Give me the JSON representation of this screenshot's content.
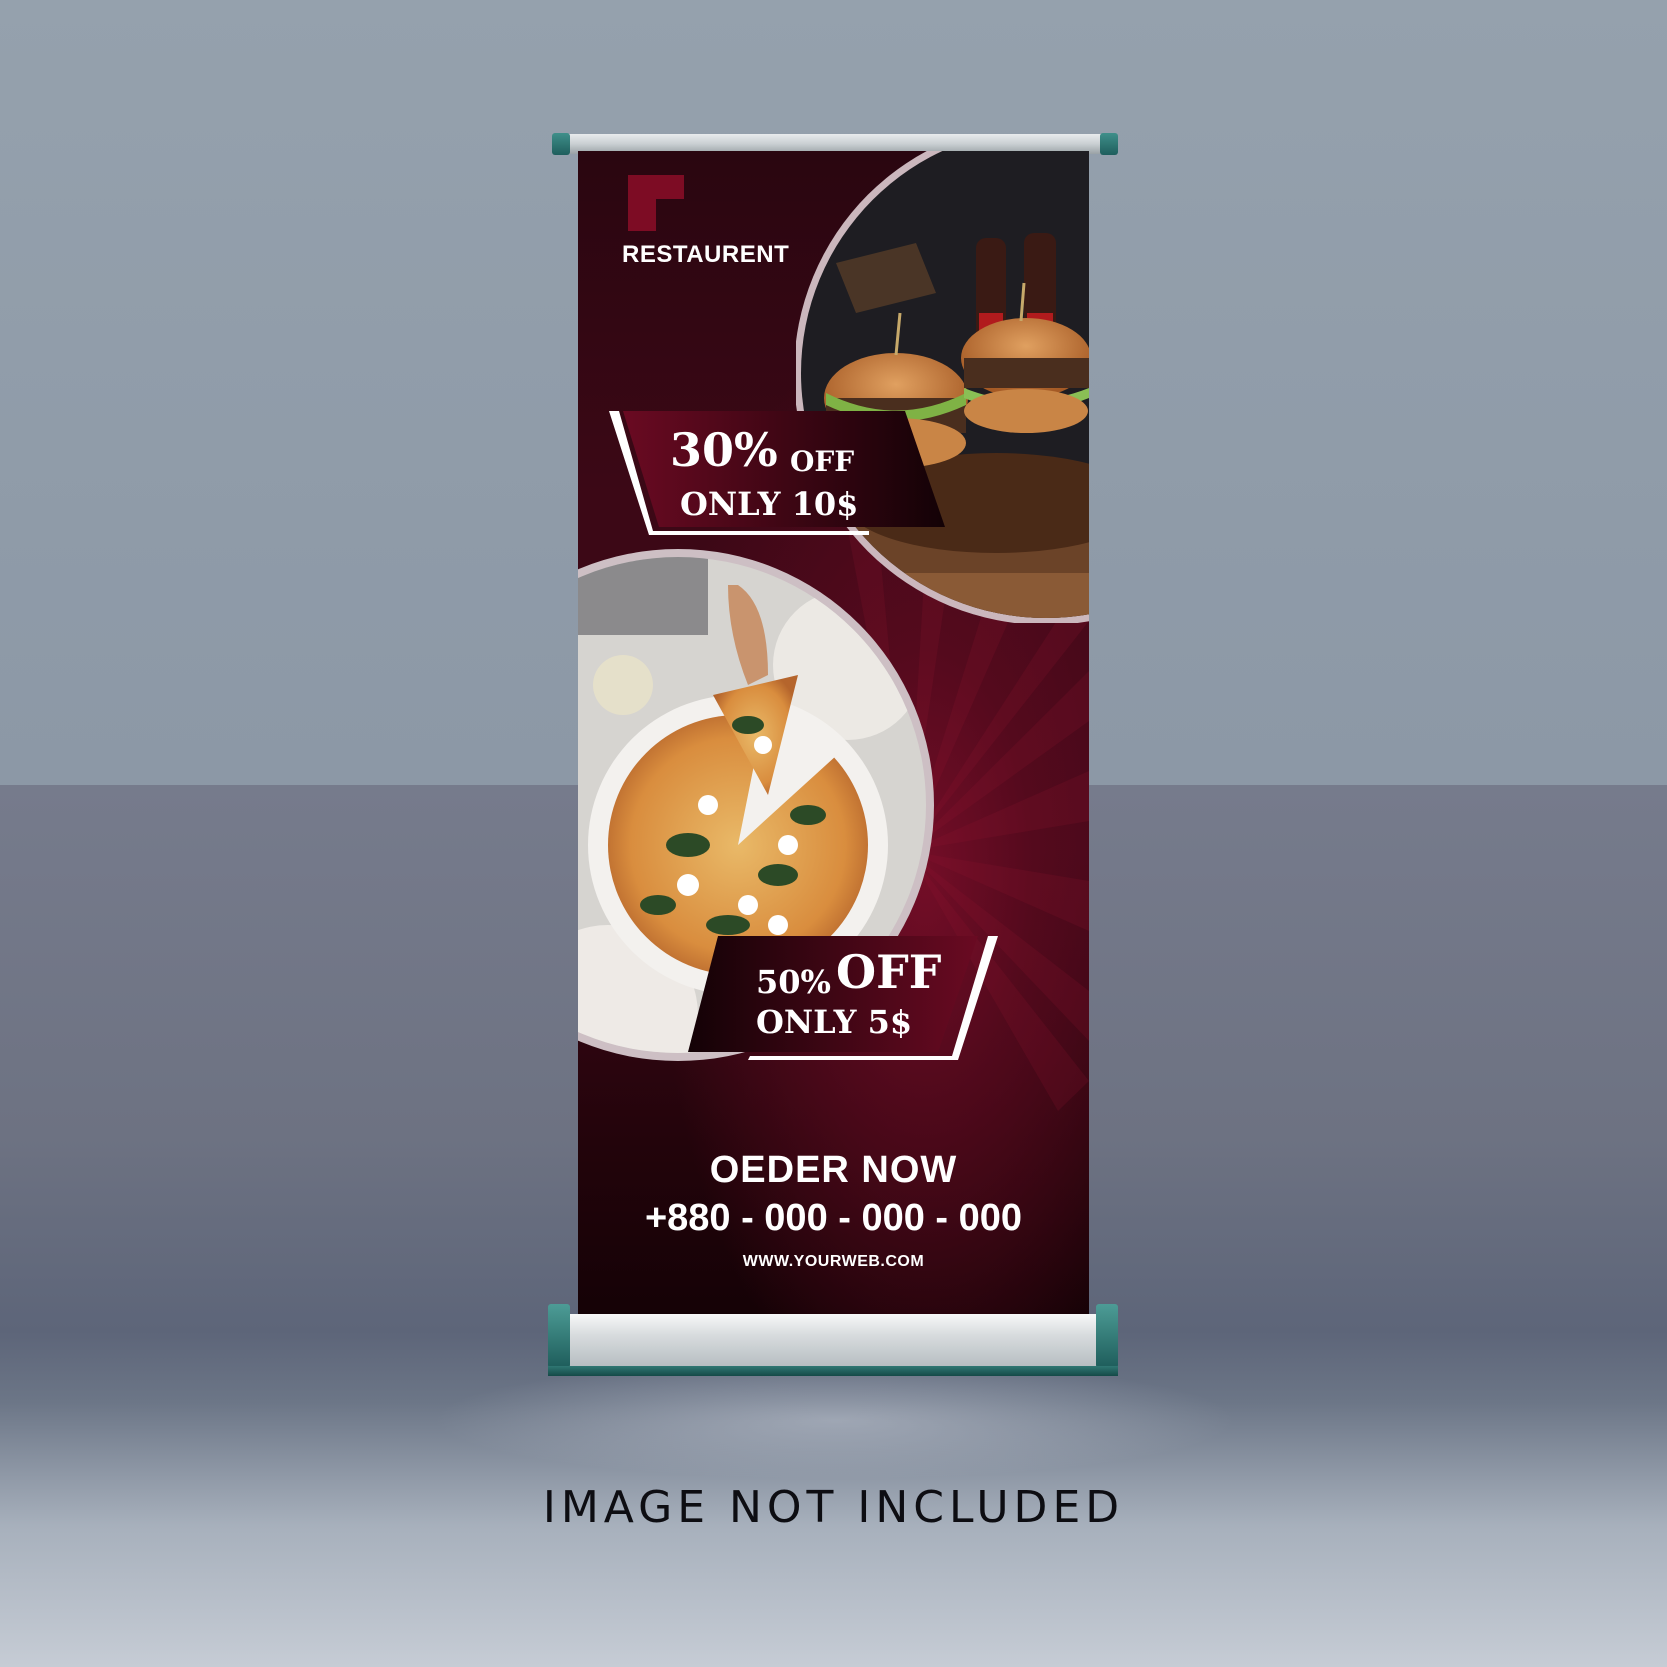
{
  "banner": {
    "brand_name": "RESTAURENT",
    "offer_1": {
      "percent": "30%",
      "off": "OFF",
      "price": "ONLY 10$"
    },
    "offer_2": {
      "percent": "50%",
      "off": "OFF",
      "price": "ONLY 5$"
    },
    "cta": "OEDER NOW",
    "phone": "+880 - 000 - 000 - 000",
    "website": "WWW.YOURWEB.COM"
  },
  "caption": "IMAGE NOT INCLUDED",
  "icons": [
    "logo-mark-icon",
    "burger-photo",
    "pizza-photo"
  ],
  "colors": {
    "banner_red": "#4a0a1c",
    "accent_red": "#7a0f2b",
    "stand_teal": "#2a6f6b",
    "text": "#ffffff"
  }
}
